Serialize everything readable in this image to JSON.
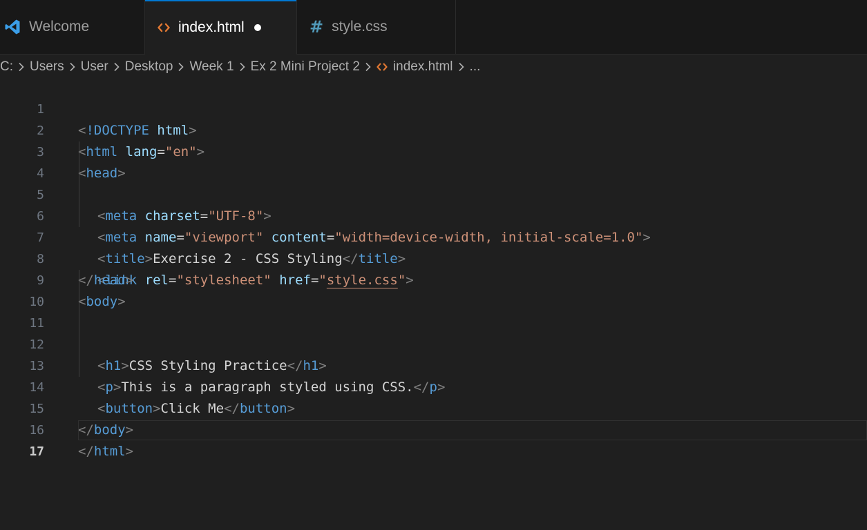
{
  "tabs": [
    {
      "label": "Welcome",
      "icon": "vscode-logo-icon"
    },
    {
      "label": "index.html",
      "icon": "html-file-icon",
      "modified": true
    },
    {
      "label": "style.css",
      "icon": "css-hash-icon",
      "glyph": "#"
    }
  ],
  "breadcrumb": {
    "segments": [
      "C:",
      "Users",
      "User",
      "Desktop",
      "Week 1",
      "Ex 2 Mini Project 2"
    ],
    "file": "index.html",
    "more": "..."
  },
  "lines": {
    "n1": "1",
    "n2": "2",
    "n3": "3",
    "n4": "4",
    "n5": "5",
    "n6": "6",
    "n7": "7",
    "n8": "8",
    "n9": "9",
    "n10": "10",
    "n11": "11",
    "n12": "12",
    "n13": "13",
    "n14": "14",
    "n15": "15",
    "n16": "16",
    "n17": "17",
    "current": "17"
  },
  "code": {
    "l1": {
      "doctype": "!DOCTYPE",
      "html": "html"
    },
    "l2": {
      "tag": "html",
      "attr": "lang",
      "val": "\"en\""
    },
    "l3": {
      "tag": "head"
    },
    "l4": {
      "tag": "meta",
      "attr": "charset",
      "val": "\"UTF-8\""
    },
    "l5": {
      "tag": "meta",
      "attr1": "name",
      "val1": "\"viewport\"",
      "attr2": "content",
      "val2": "\"width=device-width, initial-scale=1.0\""
    },
    "l6": {
      "tag": "title",
      "text": "Exercise 2 - CSS Styling"
    },
    "l7": {
      "tag": "link",
      "attr1": "rel",
      "val1": "\"stylesheet\"",
      "attr2": "href",
      "val2_open": "\"",
      "link": "style.css",
      "val2_close": "\""
    },
    "l8": {
      "tag": "head"
    },
    "l9": {
      "tag": "body"
    },
    "l11": {
      "tag": "h1",
      "text": "CSS Styling Practice"
    },
    "l12": {
      "tag": "p",
      "text": "This is a paragraph styled using CSS."
    },
    "l13": {
      "tag": "button",
      "text": "Click Me"
    },
    "l15": {
      "tag": "body"
    },
    "l16": {
      "tag": "html"
    }
  },
  "colors": {
    "editor_bg": "#1f1f1f",
    "tag": "#569cd6",
    "attribute": "#9cdcfe",
    "string": "#ce9178",
    "accent": "#0078d4"
  }
}
